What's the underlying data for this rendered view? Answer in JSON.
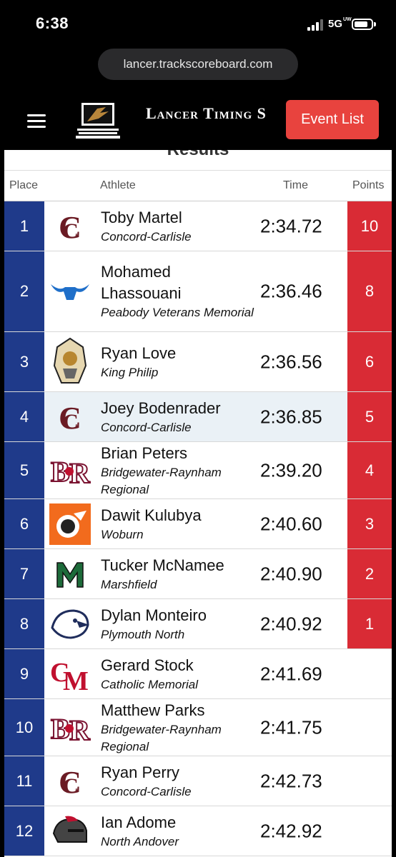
{
  "status_bar": {
    "time": "6:38",
    "network": "5G",
    "network_sub": "UW"
  },
  "browser": {
    "url": "lancer.trackscoreboard.com"
  },
  "header": {
    "brand": "Lancer Timing S",
    "event_list_label": "Event List"
  },
  "results": {
    "heading": "Results",
    "columns": {
      "place": "Place",
      "athlete": "Athlete",
      "time": "Time",
      "points": "Points"
    },
    "rows": [
      {
        "place": "1",
        "name": "Toby Martel",
        "team": "Concord-Carlisle",
        "time": "2:34.72",
        "points": "10",
        "logo": "cc-logo"
      },
      {
        "place": "2",
        "name": "Mohamed Lhassouani",
        "team": "Peabody Veterans Memorial",
        "time": "2:36.46",
        "points": "8",
        "logo": "longhorn-logo"
      },
      {
        "place": "3",
        "name": "Ryan Love",
        "team": "King Philip",
        "time": "2:36.56",
        "points": "6",
        "logo": "warrior-logo"
      },
      {
        "place": "4",
        "name": "Joey Bodenrader",
        "team": "Concord-Carlisle",
        "time": "2:36.85",
        "points": "5",
        "logo": "cc-logo"
      },
      {
        "place": "5",
        "name": "Brian Peters",
        "team": "Bridgewater-Raynham Regional",
        "time": "2:39.20",
        "points": "4",
        "logo": "br-logo"
      },
      {
        "place": "6",
        "name": "Dawit Kulubya",
        "team": "Woburn",
        "time": "2:40.60",
        "points": "3",
        "logo": "woburn-logo"
      },
      {
        "place": "7",
        "name": "Tucker McNamee",
        "team": "Marshfield",
        "time": "2:40.90",
        "points": "2",
        "logo": "m-logo"
      },
      {
        "place": "8",
        "name": "Dylan Monteiro",
        "team": "Plymouth North",
        "time": "2:40.92",
        "points": "1",
        "logo": "eagle-logo"
      },
      {
        "place": "9",
        "name": "Gerard Stock",
        "team": "Catholic Memorial",
        "time": "2:41.69",
        "points": "",
        "logo": "cm-logo"
      },
      {
        "place": "10",
        "name": "Matthew Parks",
        "team": "Bridgewater-Raynham Regional",
        "time": "2:41.75",
        "points": "",
        "logo": "br-logo"
      },
      {
        "place": "11",
        "name": "Ryan Perry",
        "team": "Concord-Carlisle",
        "time": "2:42.73",
        "points": "",
        "logo": "cc-logo"
      },
      {
        "place": "12",
        "name": "Ian Adome",
        "team": "North Andover",
        "time": "2:42.92",
        "points": "",
        "logo": "knight-logo"
      }
    ]
  },
  "colors": {
    "place_bg": "#1f3a8a",
    "points_bg": "#d92b35",
    "button_bg": "#e8433e",
    "highlight_row": "#eaf1f6"
  }
}
